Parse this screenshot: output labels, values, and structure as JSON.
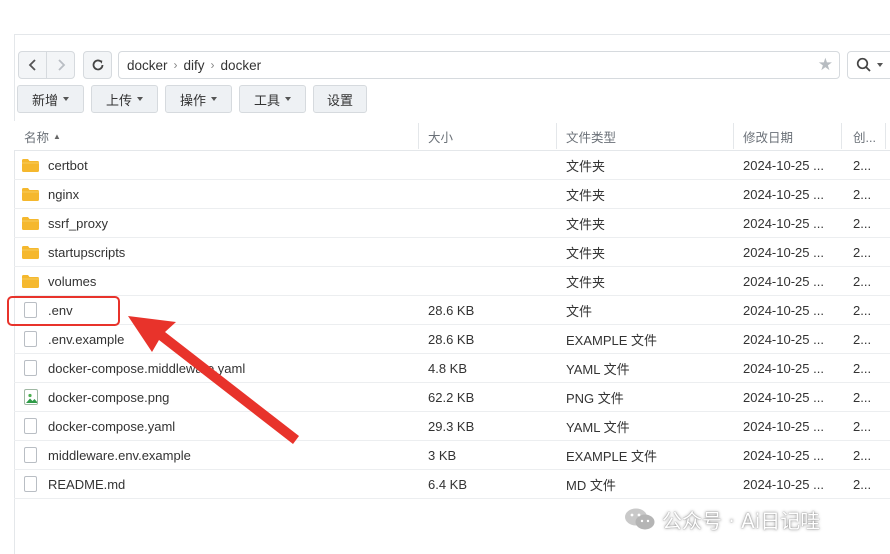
{
  "breadcrumb": [
    "docker",
    "dify",
    "docker"
  ],
  "toolbar": {
    "new_label": "新增",
    "upload_label": "上传",
    "action_label": "操作",
    "tools_label": "工具",
    "settings_label": "设置"
  },
  "columns": {
    "name": "名称",
    "size": "大小",
    "type": "文件类型",
    "modified": "修改日期",
    "created": "创..."
  },
  "rows": [
    {
      "name": "certbot",
      "size": "",
      "type": "文件夹",
      "modified": "2024-10-25 ...",
      "created": "2...",
      "icon": "folder-icon"
    },
    {
      "name": "nginx",
      "size": "",
      "type": "文件夹",
      "modified": "2024-10-25 ...",
      "created": "2...",
      "icon": "folder-icon"
    },
    {
      "name": "ssrf_proxy",
      "size": "",
      "type": "文件夹",
      "modified": "2024-10-25 ...",
      "created": "2...",
      "icon": "folder-icon"
    },
    {
      "name": "startupscripts",
      "size": "",
      "type": "文件夹",
      "modified": "2024-10-25 ...",
      "created": "2...",
      "icon": "folder-icon"
    },
    {
      "name": "volumes",
      "size": "",
      "type": "文件夹",
      "modified": "2024-10-25 ...",
      "created": "2...",
      "icon": "folder-icon"
    },
    {
      "name": ".env",
      "size": "28.6 KB",
      "type": "文件",
      "modified": "2024-10-25 ...",
      "created": "2...",
      "icon": "file-icon"
    },
    {
      "name": ".env.example",
      "size": "28.6 KB",
      "type": "EXAMPLE 文件",
      "modified": "2024-10-25 ...",
      "created": "2...",
      "icon": "file-icon"
    },
    {
      "name": "docker-compose.middleware.yaml",
      "size": "4.8 KB",
      "type": "YAML 文件",
      "modified": "2024-10-25 ...",
      "created": "2...",
      "icon": "file-icon"
    },
    {
      "name": "docker-compose.png",
      "size": "62.2 KB",
      "type": "PNG 文件",
      "modified": "2024-10-25 ...",
      "created": "2...",
      "icon": "image-icon"
    },
    {
      "name": "docker-compose.yaml",
      "size": "29.3 KB",
      "type": "YAML 文件",
      "modified": "2024-10-25 ...",
      "created": "2...",
      "icon": "file-icon"
    },
    {
      "name": "middleware.env.example",
      "size": "3 KB",
      "type": "EXAMPLE 文件",
      "modified": "2024-10-25 ...",
      "created": "2...",
      "icon": "file-icon"
    },
    {
      "name": "README.md",
      "size": "6.4 KB",
      "type": "MD 文件",
      "modified": "2024-10-25 ...",
      "created": "2...",
      "icon": "file-icon"
    }
  ],
  "watermark": "公众号 · Ai日记哇",
  "colors": {
    "folder": "#f5b82e",
    "highlight": "#e8332b",
    "border": "#d6dade",
    "button_bg": "#eef1f4"
  }
}
